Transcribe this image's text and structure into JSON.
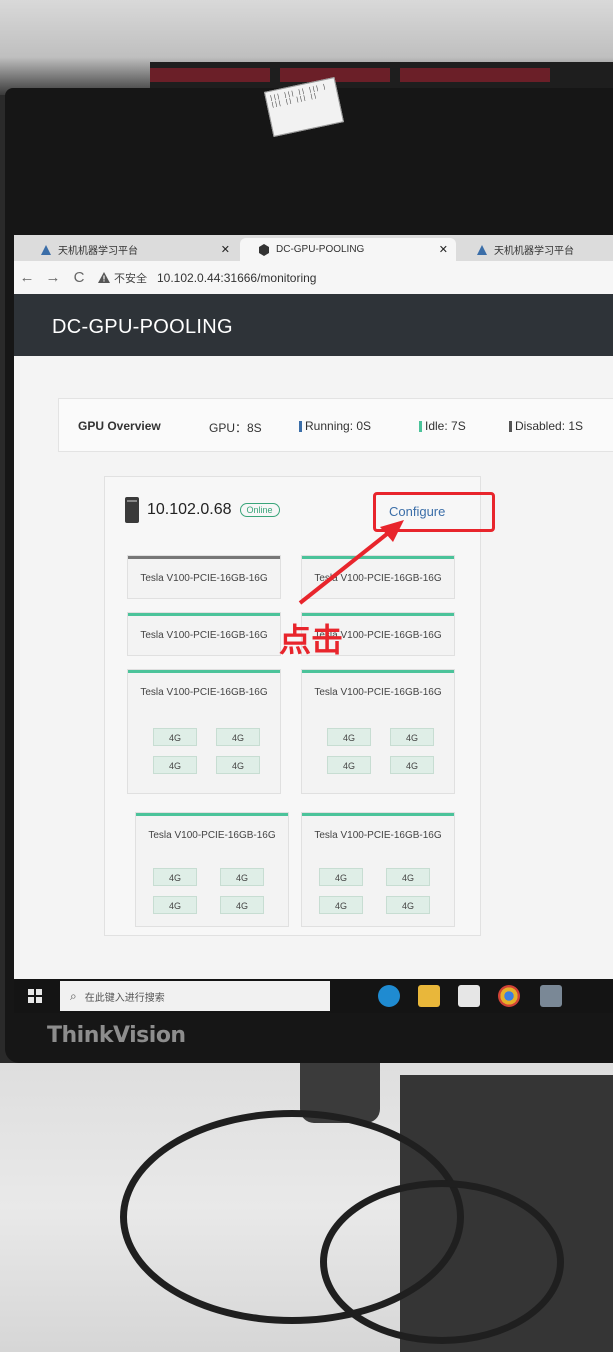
{
  "browser": {
    "tabs": [
      {
        "title": "天机机器学习平台",
        "active": false
      },
      {
        "title": "DC-GPU-POOLING",
        "active": true
      },
      {
        "title": "天机机器学习平台",
        "active": false
      }
    ],
    "security_text": "不安全",
    "url": "10.102.0.44:31666/monitoring"
  },
  "app": {
    "title": "DC-GPU-POOLING"
  },
  "overview": {
    "label": "GPU Overview",
    "gpu": "GPU：8S",
    "running": "Running: 0S",
    "idle": "Idle: 7S",
    "disabled": "Disabled: 1S",
    "colors": {
      "running": "#3b6ea8",
      "idle": "#4bc39a",
      "disabled": "#555555"
    }
  },
  "host": {
    "ip": "10.102.0.68",
    "status": "Online",
    "configure_label": "Configure"
  },
  "gpus": [
    {
      "name": "Tesla V100-PCIE-16GB-16G",
      "state": "disabled",
      "partitions": []
    },
    {
      "name": "Tesla V100-PCIE-16GB-16G",
      "state": "idle",
      "partitions": []
    },
    {
      "name": "Tesla V100-PCIE-16GB-16G",
      "state": "idle",
      "partitions": []
    },
    {
      "name": "Tesla V100-PCIE-16GB-16G",
      "state": "idle",
      "partitions": []
    },
    {
      "name": "Tesla V100-PCIE-16GB-16G",
      "state": "idle",
      "partitions": [
        "4G",
        "4G",
        "4G",
        "4G"
      ]
    },
    {
      "name": "Tesla V100-PCIE-16GB-16G",
      "state": "idle",
      "partitions": [
        "4G",
        "4G",
        "4G",
        "4G"
      ]
    },
    {
      "name": "Tesla V100-PCIE-16GB-16G",
      "state": "idle",
      "partitions": [
        "4G",
        "4G",
        "4G",
        "4G"
      ]
    },
    {
      "name": "Tesla V100-PCIE-16GB-16G",
      "state": "idle",
      "partitions": [
        "4G",
        "4G",
        "4G",
        "4G"
      ]
    }
  ],
  "taskbar": {
    "search_placeholder": "在此键入进行搜索"
  },
  "annotation": {
    "text": "点击",
    "color": "#e8252c"
  },
  "monitor_brand": "ThinkVision"
}
